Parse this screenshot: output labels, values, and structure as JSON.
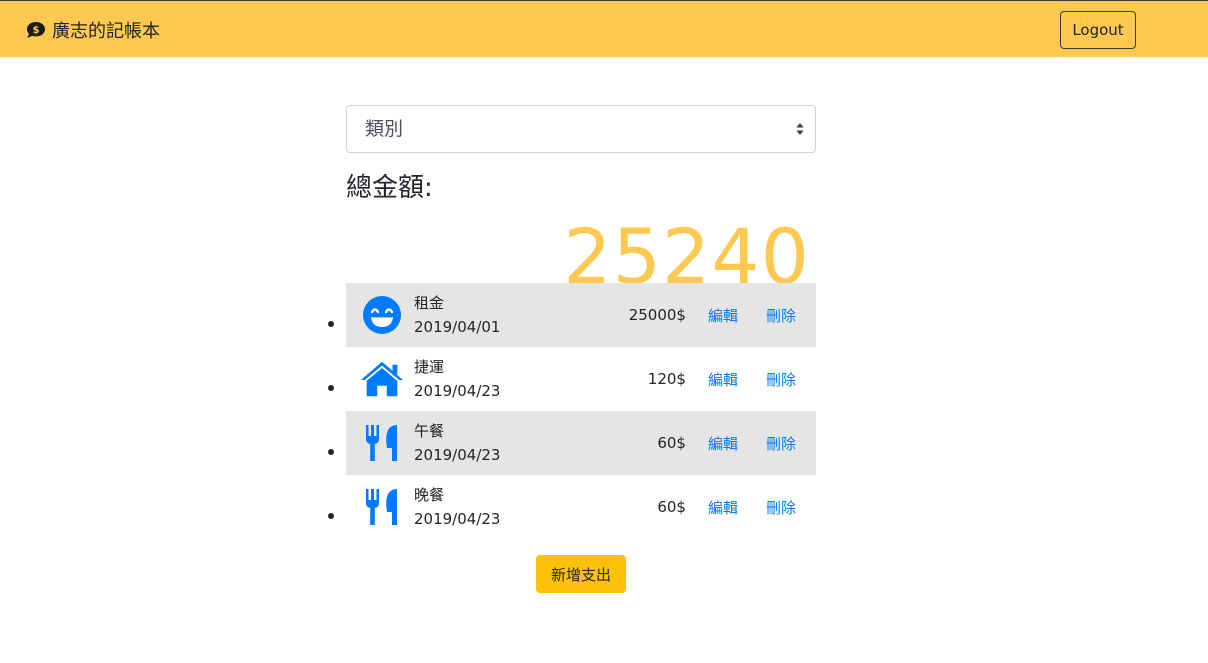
{
  "navbar": {
    "brand_icon": "comment-dollar-icon",
    "brand_text": "廣志的記帳本",
    "logout_label": "Logout",
    "background_color": "#ffc851"
  },
  "filter": {
    "selected": "類別"
  },
  "total": {
    "label": "總金額:",
    "value": "25240",
    "color": "#ffc851"
  },
  "records": [
    {
      "icon": "grin-icon",
      "name": "租金",
      "date": "2019/04/01",
      "amount": "25000$",
      "edit_label": "編輯",
      "delete_label": "刪除"
    },
    {
      "icon": "home-icon",
      "name": "捷運",
      "date": "2019/04/23",
      "amount": "120$",
      "edit_label": "編輯",
      "delete_label": "刪除"
    },
    {
      "icon": "utensils-icon",
      "name": "午餐",
      "date": "2019/04/23",
      "amount": "60$",
      "edit_label": "編輯",
      "delete_label": "刪除"
    },
    {
      "icon": "utensils-icon",
      "name": "晚餐",
      "date": "2019/04/23",
      "amount": "60$",
      "edit_label": "編輯",
      "delete_label": "刪除"
    }
  ],
  "add_button": {
    "label": "新增支出",
    "color": "#ffc107"
  },
  "icon_color": "#007bff"
}
